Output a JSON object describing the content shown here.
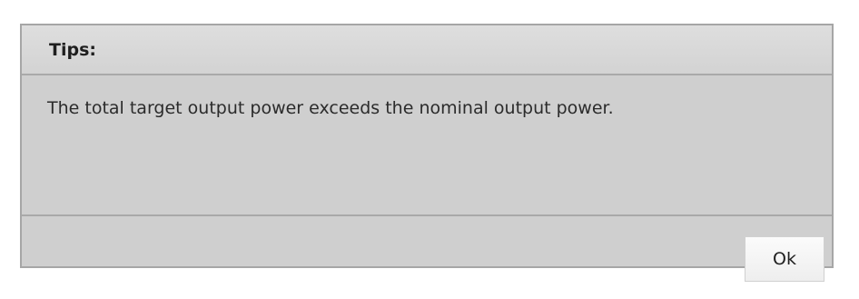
{
  "dialog": {
    "title": "Tips:",
    "message": "The total target output power exceeds the nominal output power.",
    "ok_label": "Ok"
  }
}
